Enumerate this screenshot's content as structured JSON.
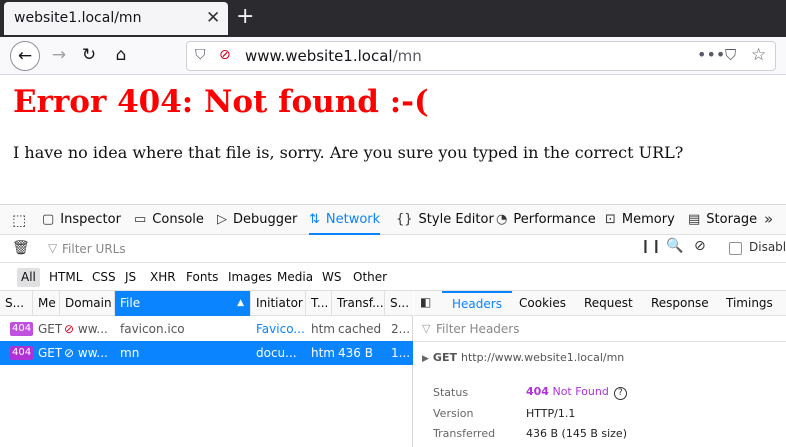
{
  "browser": {
    "tab_title": "website1.local/mn",
    "url_host": "www.website1.local",
    "url_path": "/mn"
  },
  "page": {
    "heading": "Error 404: Not found :-(",
    "message": "I have no idea where that file is, sorry. Are you sure you typed in the correct URL?"
  },
  "devtools": {
    "tabs": [
      {
        "label": "Inspector",
        "icon": "inspector-icon"
      },
      {
        "label": "Console",
        "icon": "console-icon"
      },
      {
        "label": "Debugger",
        "icon": "debugger-icon"
      },
      {
        "label": "Network",
        "icon": "network-icon",
        "active": true
      },
      {
        "label": "Style Editor",
        "icon": "style-editor-icon"
      },
      {
        "label": "Performance",
        "icon": "performance-icon"
      },
      {
        "label": "Memory",
        "icon": "memory-icon"
      },
      {
        "label": "Storage",
        "icon": "storage-icon"
      }
    ],
    "filter_placeholder": "Filter URLs",
    "disable_label": "Disable",
    "type_filters": [
      "All",
      "HTML",
      "CSS",
      "JS",
      "XHR",
      "Fonts",
      "Images",
      "Media",
      "WS",
      "Other"
    ],
    "columns": [
      "S...",
      "Me",
      "Domain",
      "File",
      "Initiator",
      "T...",
      "Transf...",
      "S..."
    ],
    "rows": [
      {
        "status": "404",
        "method": "GET",
        "domain": "ww...",
        "file": "favicon.ico",
        "initiator": "Favico...",
        "type": "htm",
        "transferred": "cached",
        "size": "2..."
      },
      {
        "status": "404",
        "method": "GET",
        "domain": "ww...",
        "file": "mn",
        "initiator": "docu...",
        "type": "htm",
        "transferred": "436 B",
        "size": "1..."
      }
    ],
    "detail_tabs": [
      "Headers",
      "Cookies",
      "Request",
      "Response",
      "Timings"
    ],
    "headers_filter_placeholder": "Filter Headers",
    "request_summary": {
      "method": "GET",
      "url": "http://www.website1.local/mn"
    },
    "fields": {
      "status_label": "Status",
      "status_code": "404",
      "status_text": "Not Found",
      "version_label": "Version",
      "version_value": "HTTP/1.1",
      "transferred_label": "Transferred",
      "transferred_value": "436 B (145 B size)"
    }
  }
}
